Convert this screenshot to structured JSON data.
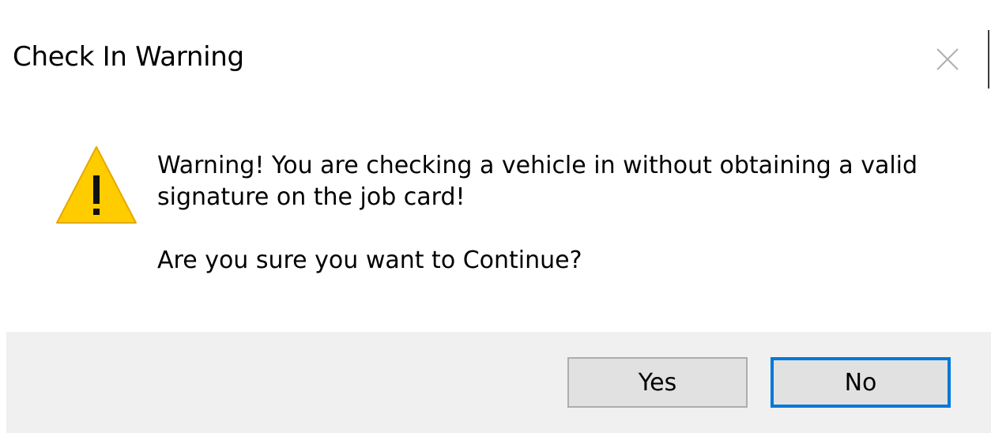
{
  "dialog": {
    "title": "Check In Warning",
    "close_icon": "close-icon",
    "warning_icon": "warning-triangle-icon",
    "message_line": "Warning! You are checking a vehicle in without obtaining a valid signature on the job card!",
    "question": "Are you sure you want to Continue?",
    "buttons": {
      "yes_label": "Yes",
      "no_label": "No",
      "default": "No"
    },
    "colors": {
      "warning_fill": "#FFCC00",
      "footer_bg": "#F0F0F0",
      "button_bg": "#E1E1E1",
      "focus_border": "#0078D7"
    }
  }
}
